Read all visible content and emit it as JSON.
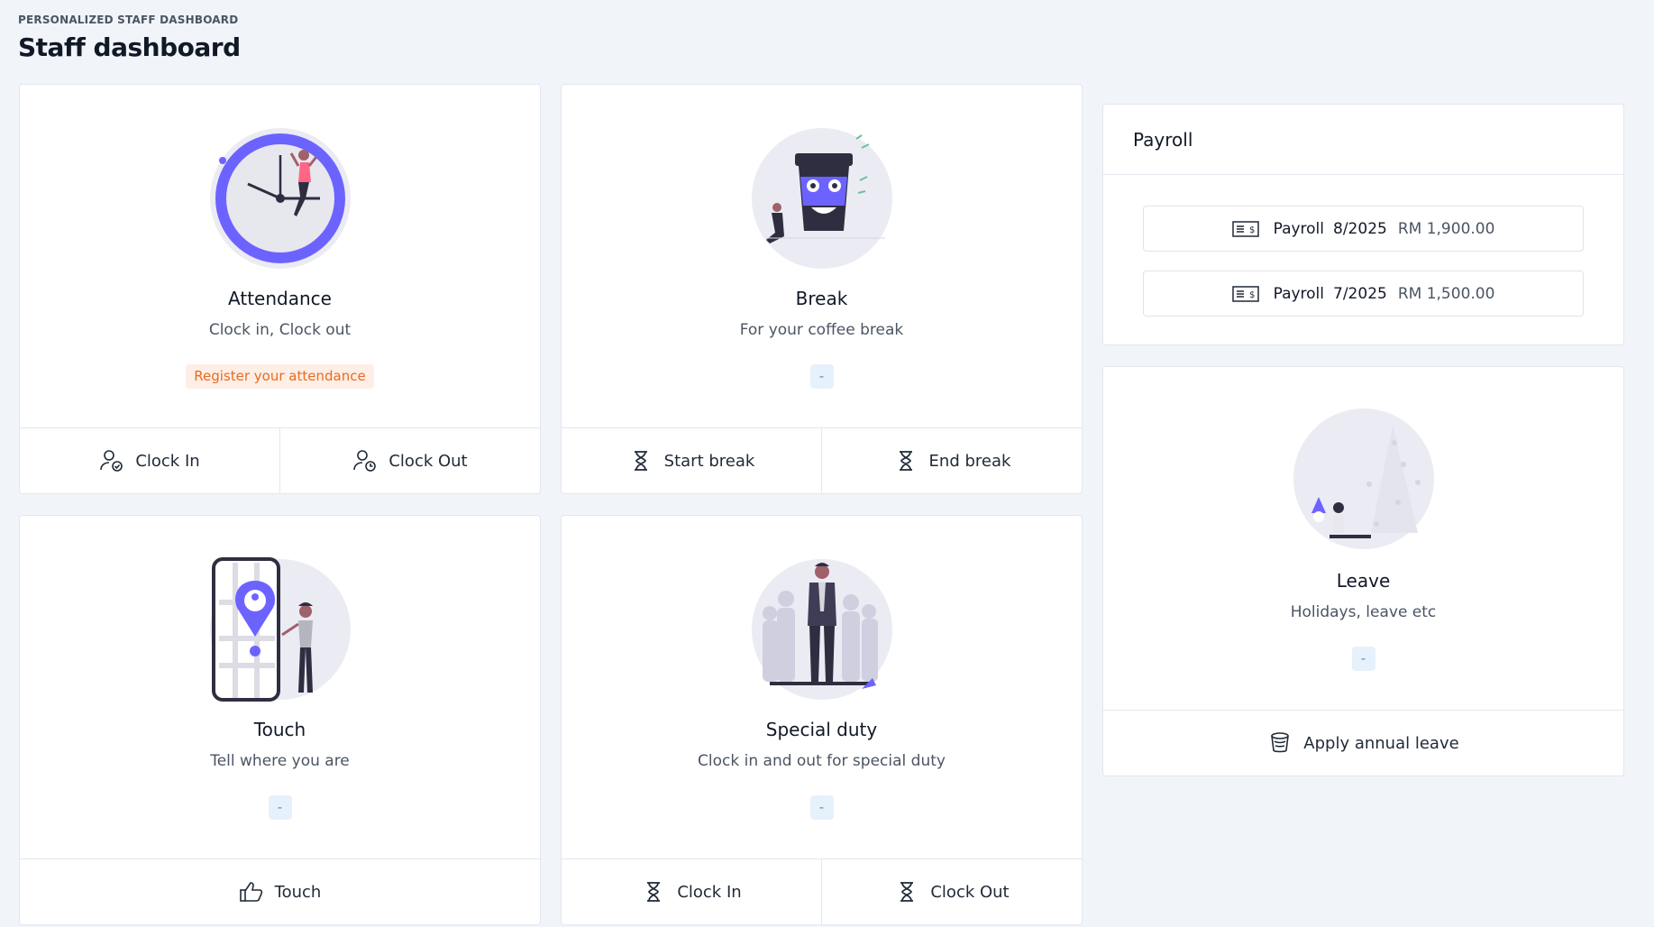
{
  "header": {
    "eyebrow": "PERSONALIZED STAFF DASHBOARD",
    "title": "Staff dashboard"
  },
  "attendance": {
    "title": "Attendance",
    "subtitle": "Clock in, Clock out",
    "badge": "Register your attendance",
    "btn_in": "Clock In",
    "btn_out": "Clock Out"
  },
  "break": {
    "title": "Break",
    "subtitle": "For your coffee break",
    "badge": "-",
    "btn_start": "Start break",
    "btn_end": "End break"
  },
  "touch": {
    "title": "Touch",
    "subtitle": "Tell where you are",
    "badge": "-",
    "btn": "Touch"
  },
  "special": {
    "title": "Special duty",
    "subtitle": "Clock in and out for special duty",
    "badge": "-",
    "btn_in": "Clock In",
    "btn_out": "Clock Out"
  },
  "payroll": {
    "title": "Payroll",
    "items": [
      {
        "label": "Payroll",
        "period": "8/2025",
        "amount": "RM 1,900.00"
      },
      {
        "label": "Payroll",
        "period": "7/2025",
        "amount": "RM 1,500.00"
      }
    ]
  },
  "leave": {
    "title": "Leave",
    "subtitle": "Holidays, leave etc",
    "badge": "-",
    "btn": "Apply annual leave"
  },
  "colors": {
    "accent": "#6c63ff",
    "background": "#f1f4f8",
    "warn_badge_text": "#ea6b20",
    "info_badge_text": "#5a8fc2"
  },
  "icons": {
    "clock_in": "user-check-icon",
    "clock_out": "user-clock-icon",
    "break": "hourglass-icon",
    "touch": "thumbs-up-icon",
    "payroll": "money-bill-icon",
    "leave": "coffee-cup-icon"
  }
}
